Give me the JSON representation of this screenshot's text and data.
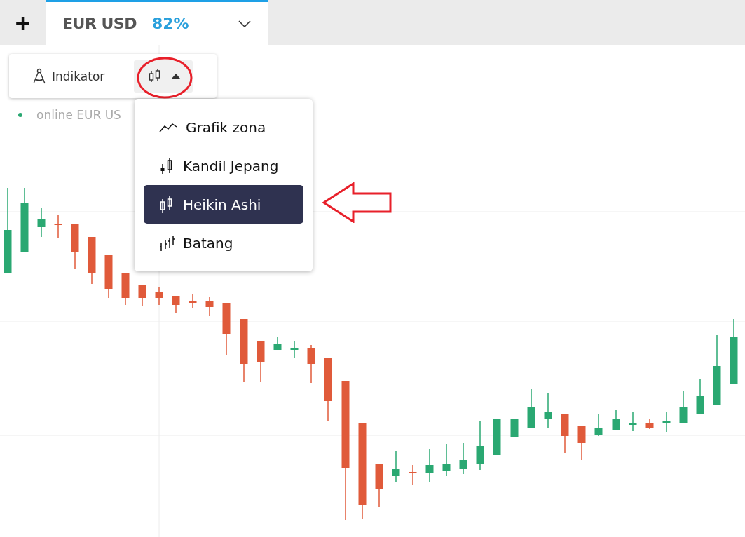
{
  "tab_bar": {
    "add_button": "+",
    "tabs": [
      {
        "symbol": "EUR USD",
        "payout": "82%",
        "selected": true
      }
    ]
  },
  "toolbar": {
    "indicator_button": "Indikator",
    "chart_type_button": {
      "expanded": true
    }
  },
  "status": {
    "text": "online EUR US",
    "online": true
  },
  "chart_type_menu": {
    "items": [
      {
        "label": "Grafik zona",
        "kind": "area",
        "selected": false
      },
      {
        "label": "Kandil Jepang",
        "kind": "candles",
        "selected": false
      },
      {
        "label": "Heikin Ashi",
        "kind": "heikin",
        "selected": true
      },
      {
        "label": "Batang",
        "kind": "bars",
        "selected": false
      }
    ]
  }
}
